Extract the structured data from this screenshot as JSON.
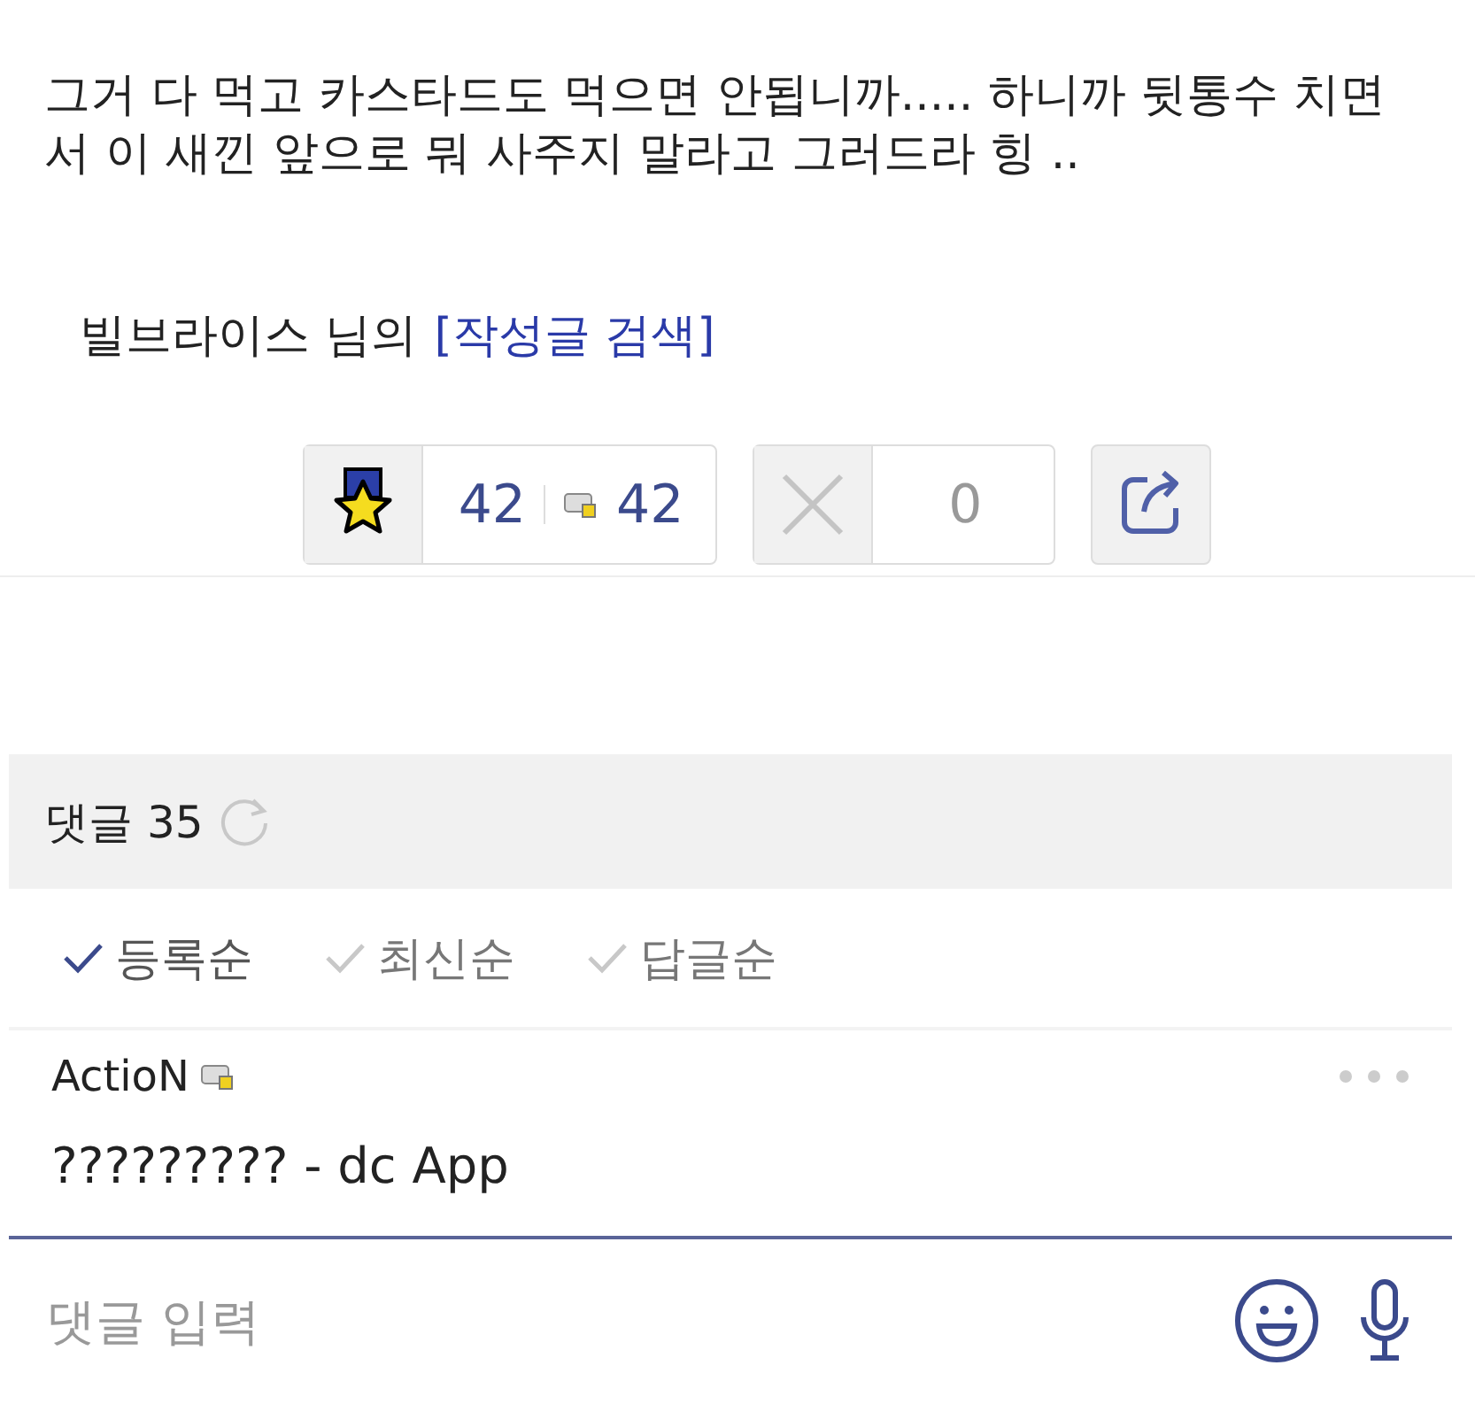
{
  "post": {
    "body": "그거 다 먹고 카스타드도 먹으면 안됩니까..... 하니까 뒷통수 치면서 이 새낀 앞으로 뭐 사주지 말라고 그러드라 힝 ..",
    "author": "빌브라이스 님의",
    "author_link": "[작성글 검색]"
  },
  "votes": {
    "up": "42",
    "fixed_up": "42",
    "down": "0"
  },
  "comments": {
    "title": "댓글 35",
    "sort_options": [
      {
        "label": "등록순",
        "selected": true
      },
      {
        "label": "최신순",
        "selected": false
      },
      {
        "label": "답글순",
        "selected": false
      }
    ],
    "items": [
      {
        "author": "ActioN",
        "text": "????????? - dc App"
      }
    ]
  },
  "input": {
    "placeholder": "댓글 입력"
  }
}
